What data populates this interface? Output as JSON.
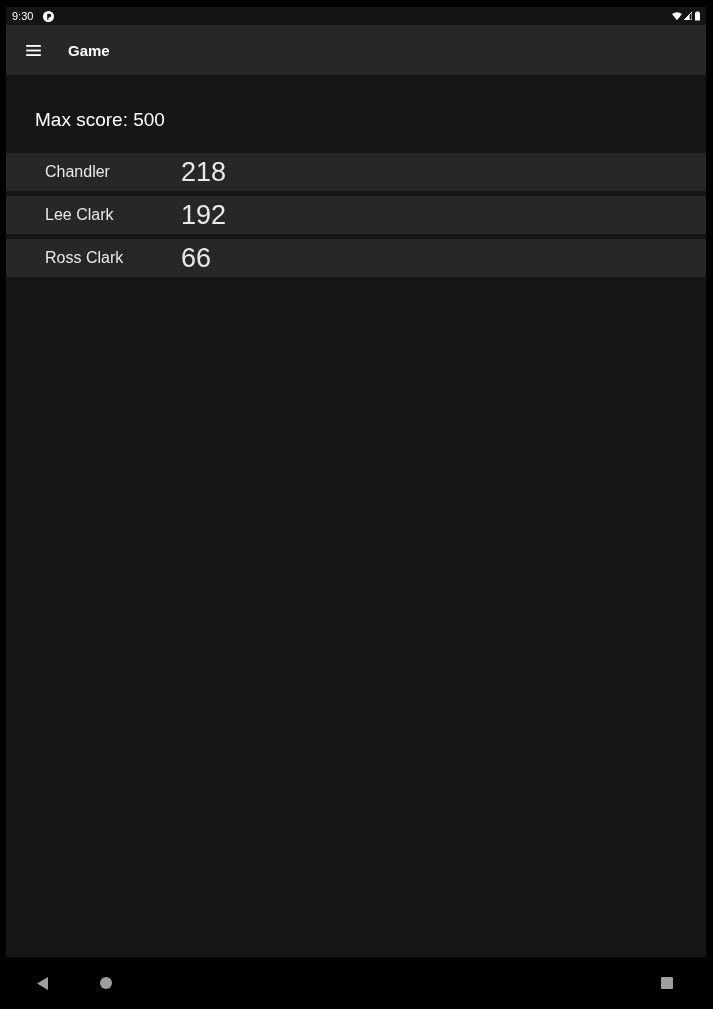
{
  "status_bar": {
    "time": "9:30"
  },
  "app_bar": {
    "title": "Game"
  },
  "max_score": "Max score: 500",
  "players": [
    {
      "name": "Chandler",
      "score": "218"
    },
    {
      "name": "Lee Clark",
      "score": "192"
    },
    {
      "name": "Ross Clark",
      "score": "66"
    }
  ]
}
